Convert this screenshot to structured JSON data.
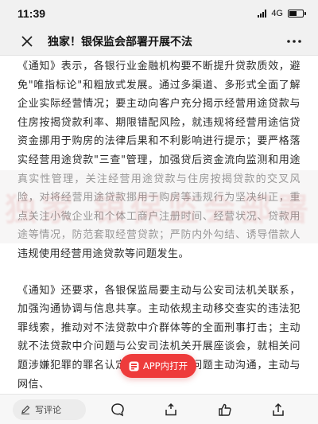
{
  "status_bar": {
    "time": "11:39",
    "network": "4G"
  },
  "nav": {
    "title": "独家！银保监会部署开展不法"
  },
  "article": {
    "paragraphs": [
      "《通知》表示，各银行业金融机构要不断提升贷款质效，避免\"唯指标论\"和粗放式发展。通过多渠道、多形式全面了解企业实际经营情况；要主动向客户充分揭示经营用途贷款与住房按揭贷款利率、期限错配风险，就违规将经营用途信贷资金挪用于购房的法律后果和不利影响进行提示；要严格落实经营用途贷款\"三查\"管理，加强贷后资金流向监测和用途真实性管理，关注经营用途贷款与住房按揭贷款的交叉风险，对将经营用途贷款挪用于购房等违规行为坚决纠正，重点关注小微企业和个体工商户注册时间、经营状况、贷款用途等情况，防范套取经营贷款；严防内外勾结、诱导借款人违规使用经营用途贷款等问题发生。",
      "《通知》还要求，各银保监局要主动与公安司法机关联系，加强沟通协调与信息共享。主动依规主动移交查实的违法犯罪线索，推动对不法贷款中介群体等的全面刑事打击；主动就不法贷款中介问题与公安司法机关开展座谈会，就相关问题涉嫌犯罪的罪名认定及证据采信等问题主动沟通，主动与网信、"
    ]
  },
  "watermark": {
    "text": "独家 银保监会部署"
  },
  "floating_button": {
    "label": "APP内打开"
  },
  "bottom_bar": {
    "comment_placeholder": "写评论"
  },
  "colors": {
    "accent": "#ee3b3b",
    "bar_bg": "#f1f1f1",
    "text": "#2a2a2a"
  },
  "icons": [
    "close-icon",
    "more-icon",
    "pencil-icon",
    "comment-icon",
    "like-icon",
    "share-icon",
    "app-logo-icon"
  ]
}
